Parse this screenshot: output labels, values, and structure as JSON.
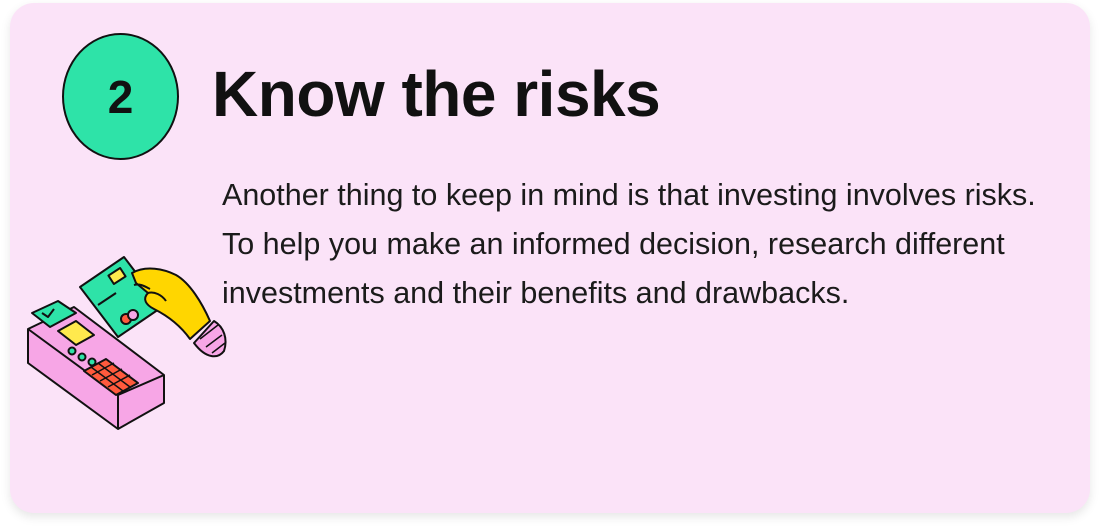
{
  "card": {
    "step_number": "2",
    "title": "Know the risks",
    "body": "Another thing to keep in mind is that investing involves risks. To help you make an informed decision, research different investments and their benefits and drawbacks."
  },
  "colors": {
    "card_background": "#fbe3f8",
    "badge_fill": "#2ee3a8",
    "text": "#111111"
  },
  "illustration": {
    "icon": "card-payment-terminal-icon"
  }
}
